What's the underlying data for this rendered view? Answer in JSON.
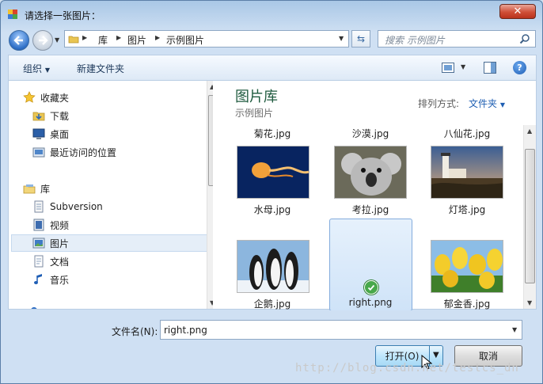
{
  "window": {
    "title": "请选择一张图片："
  },
  "nav": {
    "breadcrumb": [
      "库",
      "图片",
      "示例图片"
    ],
    "search_placeholder": "搜索 示例图片"
  },
  "toolbar": {
    "organize_label": "组织",
    "new_folder_label": "新建文件夹"
  },
  "sidebar": {
    "favorites_label": "收藏夹",
    "favorites": [
      "下载",
      "桌面",
      "最近访问的位置"
    ],
    "libraries_label": "库",
    "libraries": [
      "Subversion",
      "视频",
      "图片",
      "文档",
      "音乐"
    ],
    "selected": "图片"
  },
  "library": {
    "title": "图片库",
    "subtitle": "示例图片",
    "arrange_label": "排列方式:",
    "arrange_value": "文件夹"
  },
  "files": {
    "top_row": [
      "菊花.jpg",
      "沙漠.jpg",
      "八仙花.jpg"
    ],
    "row2": [
      "水母.jpg",
      "考拉.jpg",
      "灯塔.jpg"
    ],
    "row3": [
      "企鹅.jpg",
      "right.png",
      "郁金香.jpg"
    ],
    "selected": "right.png"
  },
  "bottom": {
    "filename_label": "文件名(N):",
    "filename_value": "right.png",
    "open_label": "打开(O)",
    "cancel_label": "取消"
  },
  "watermark": "http://blog.csdn.net/testcs_dn"
}
